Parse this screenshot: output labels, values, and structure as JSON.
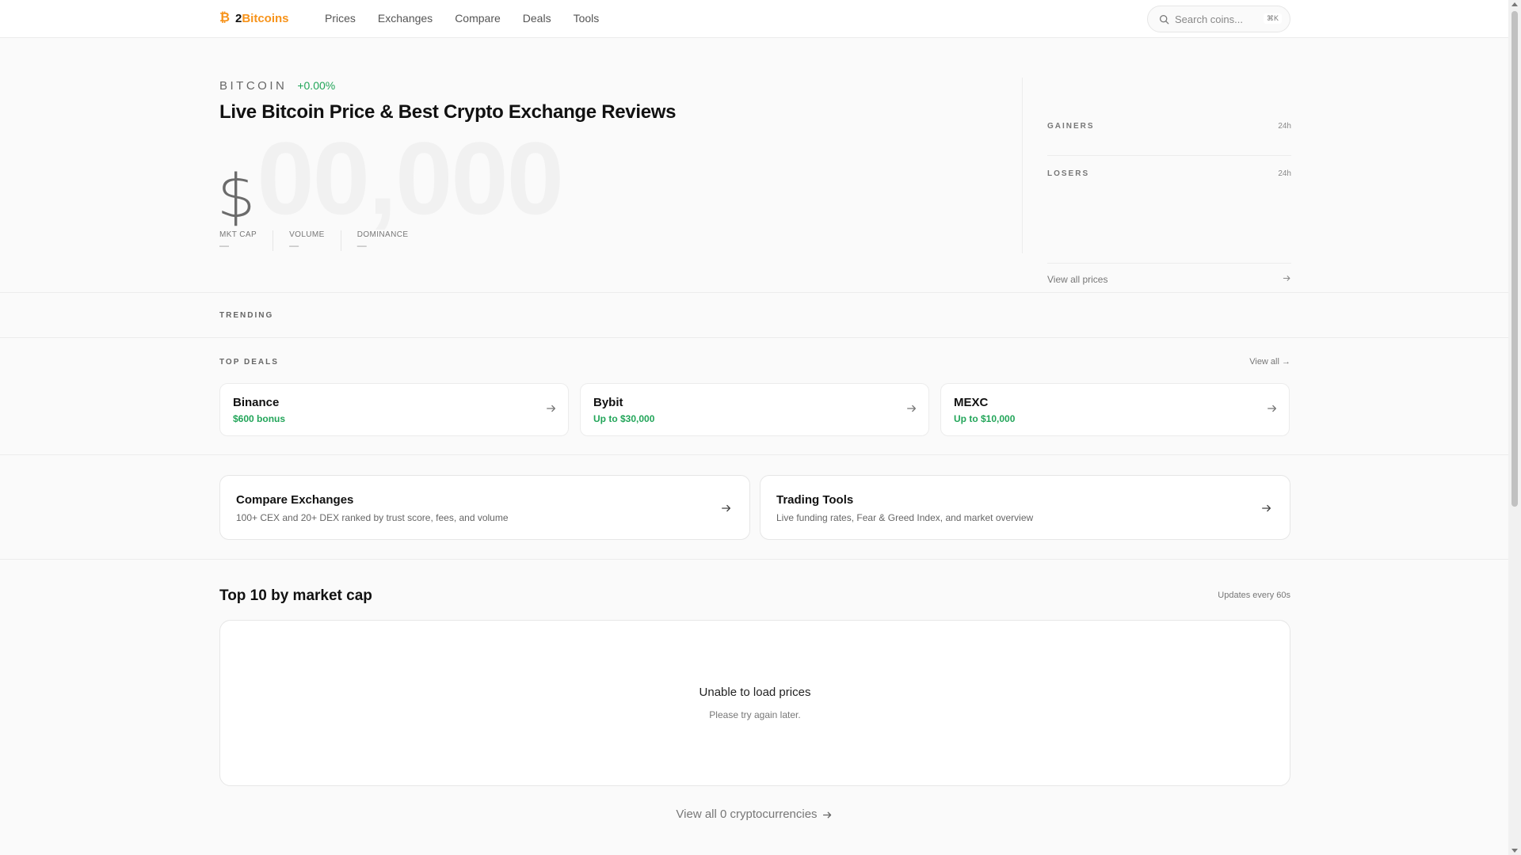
{
  "brand": {
    "prefix": "2",
    "accent": "Bitcoins",
    "icon": "bitcoin-icon",
    "accent_color": "#f7931a"
  },
  "nav": [
    "Prices",
    "Exchanges",
    "Compare",
    "Deals",
    "Tools"
  ],
  "search": {
    "placeholder": "Search coins...",
    "shortcut": "⌘K"
  },
  "hero": {
    "coin": "BITCOIN",
    "change": "+0.00%",
    "title": "Live Bitcoin Price & Best Crypto Exchange Reviews",
    "currency_symbol": "$",
    "price_placeholder": "00,000",
    "stats": [
      {
        "label": "MKT CAP",
        "value": "—"
      },
      {
        "label": "VOLUME",
        "value": "—"
      },
      {
        "label": "DOMINANCE",
        "value": "—"
      }
    ]
  },
  "movers": {
    "gainers": {
      "label": "GAINERS",
      "period": "24h"
    },
    "losers": {
      "label": "LOSERS",
      "period": "24h"
    },
    "view_all": "View all prices"
  },
  "trending": {
    "label": "TRENDING"
  },
  "deals": {
    "label": "TOP DEALS",
    "view_all": "View all →",
    "items": [
      {
        "name": "Binance",
        "offer": "$600 bonus"
      },
      {
        "name": "Bybit",
        "offer": "Up to $30,000"
      },
      {
        "name": "MEXC",
        "offer": "Up to $10,000"
      }
    ],
    "offer_color": "#22a559"
  },
  "features": [
    {
      "title": "Compare Exchanges",
      "desc": "100+ CEX and 20+ DEX ranked by trust score, fees, and volume"
    },
    {
      "title": "Trading Tools",
      "desc": "Live funding rates, Fear & Greed Index, and market overview"
    }
  ],
  "top10": {
    "title": "Top 10 by market cap",
    "note": "Updates every 60s",
    "error_title": "Unable to load prices",
    "error_sub": "Please try again later.",
    "view_all": "View all 0 cryptocurrencies"
  }
}
